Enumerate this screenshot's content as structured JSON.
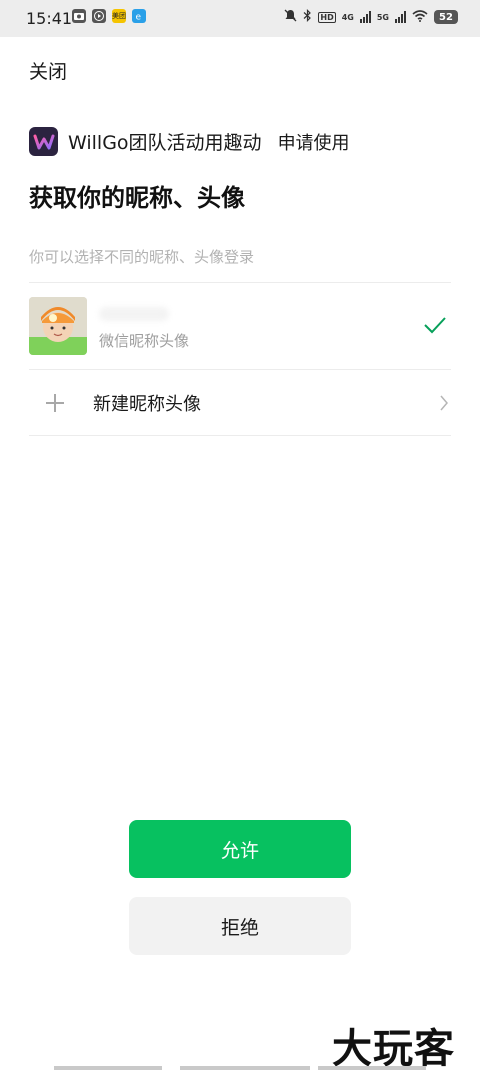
{
  "status_bar": {
    "time": "15:41",
    "left_icons": [
      "camera-app-icon",
      "media-app-icon",
      "meituan-app-icon",
      "browser-app-icon"
    ],
    "meituan_label": "美团",
    "network_4g": "4G",
    "network_5g": "5G",
    "hd_label": "HD",
    "battery": "52"
  },
  "header": {
    "close_label": "关闭"
  },
  "app": {
    "logo_icon": "willgo-logo-icon",
    "name": "WillGo团队活动用趣动",
    "action": "申请使用"
  },
  "permission": {
    "title": "获取你的昵称、头像",
    "hint": "你可以选择不同的昵称、头像登录"
  },
  "options": {
    "wechat": {
      "subtitle": "微信昵称头像",
      "selected": true
    },
    "new_profile": {
      "label": "新建昵称头像"
    }
  },
  "buttons": {
    "allow": "允许",
    "reject": "拒绝"
  },
  "watermark": "大玩客",
  "colors": {
    "accent_green": "#07c160",
    "check_green": "#07a05a",
    "hint_gray": "#b2b2b2"
  }
}
